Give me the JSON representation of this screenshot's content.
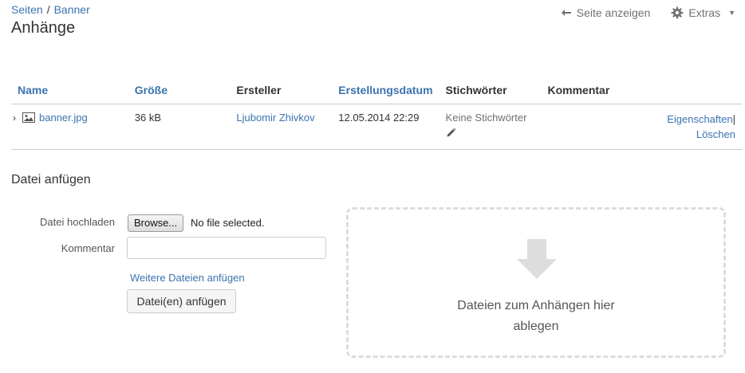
{
  "breadcrumb": {
    "items": [
      "Seiten",
      "Banner"
    ],
    "separator": "/"
  },
  "page_title": "Anhänge",
  "header_actions": {
    "view_page": "Seite anzeigen",
    "tools": "Extras"
  },
  "table": {
    "columns": [
      "Name",
      "Größe",
      "Ersteller",
      "Erstellungsdatum",
      "Stichwörter",
      "Kommentar"
    ],
    "rows": [
      {
        "name": "banner.jpg",
        "size": "36 kB",
        "creator": "Ljubomir Zhivkov",
        "date": "12.05.2014 22:29",
        "labels": "Keine Stichwörter",
        "comment": "",
        "op_properties": "Eigenschaften",
        "op_delete": "Löschen"
      }
    ]
  },
  "attach": {
    "title": "Datei anfügen",
    "upload_label": "Datei hochladen",
    "browse_label": "Browse...",
    "no_file": "No file selected.",
    "comment_label": "Kommentar",
    "comment_value": "",
    "more_files": "Weitere Dateien anfügen",
    "submit": "Datei(en) anfügen",
    "drop_line1": "Dateien zum Anhängen hier",
    "drop_line2": "ablegen"
  },
  "colors": {
    "link": "#3b73af",
    "text": "#333333",
    "muted": "#707070",
    "border": "#cccccc",
    "dropzone": "#dddddd"
  },
  "icons": [
    "back-arrow-icon",
    "gear-icon",
    "caret-down-icon",
    "chevron-right-icon",
    "image-file-icon",
    "pencil-icon",
    "down-arrow-icon"
  ]
}
